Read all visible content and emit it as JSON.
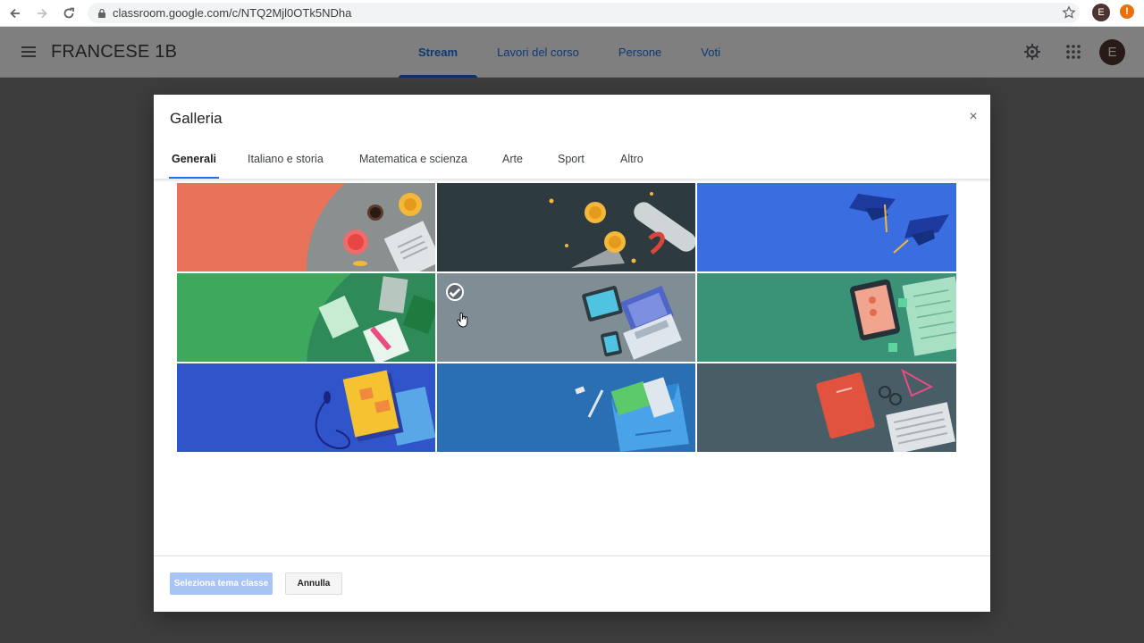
{
  "browser": {
    "url": "classroom.google.com/c/NTQ2Mjl0OTk5NDha",
    "profile_initial": "E",
    "alert_glyph": "!"
  },
  "header": {
    "class_name": "FRANCESE 1B",
    "tabs": [
      {
        "label": "Stream",
        "active": true
      },
      {
        "label": "Lavori del corso",
        "active": false
      },
      {
        "label": "Persone",
        "active": false
      },
      {
        "label": "Voti",
        "active": false
      }
    ],
    "avatar_initial": "E"
  },
  "dialog": {
    "title": "Galleria",
    "close_glyph": "×",
    "tabs": [
      {
        "label": "Generali",
        "active": true
      },
      {
        "label": "Italiano e storia",
        "active": false
      },
      {
        "label": "Matematica e scienza",
        "active": false
      },
      {
        "label": "Arte",
        "active": false
      },
      {
        "label": "Sport",
        "active": false
      },
      {
        "label": "Altro",
        "active": false
      }
    ],
    "themes": [
      {
        "name": "tea-and-books",
        "color": "#e8725a",
        "selected": false
      },
      {
        "name": "diploma-and-coins",
        "color": "#2d3a3f",
        "selected": false
      },
      {
        "name": "graduation-caps",
        "color": "#3a6ee0",
        "selected": false
      },
      {
        "name": "notebooks-green",
        "color": "#3ea85d",
        "selected": false
      },
      {
        "name": "laptop-and-tablet",
        "color": "#7f8e95",
        "selected": true
      },
      {
        "name": "phone-and-papers",
        "color": "#3a9377",
        "selected": false
      },
      {
        "name": "headphones-and-book",
        "color": "#3054c9",
        "selected": false
      },
      {
        "name": "backpack",
        "color": "#2a6fb3",
        "selected": false
      },
      {
        "name": "red-book-and-newspaper",
        "color": "#485d66",
        "selected": false
      }
    ],
    "primary_button": "Seleziona tema classe",
    "secondary_button": "Annulla"
  }
}
